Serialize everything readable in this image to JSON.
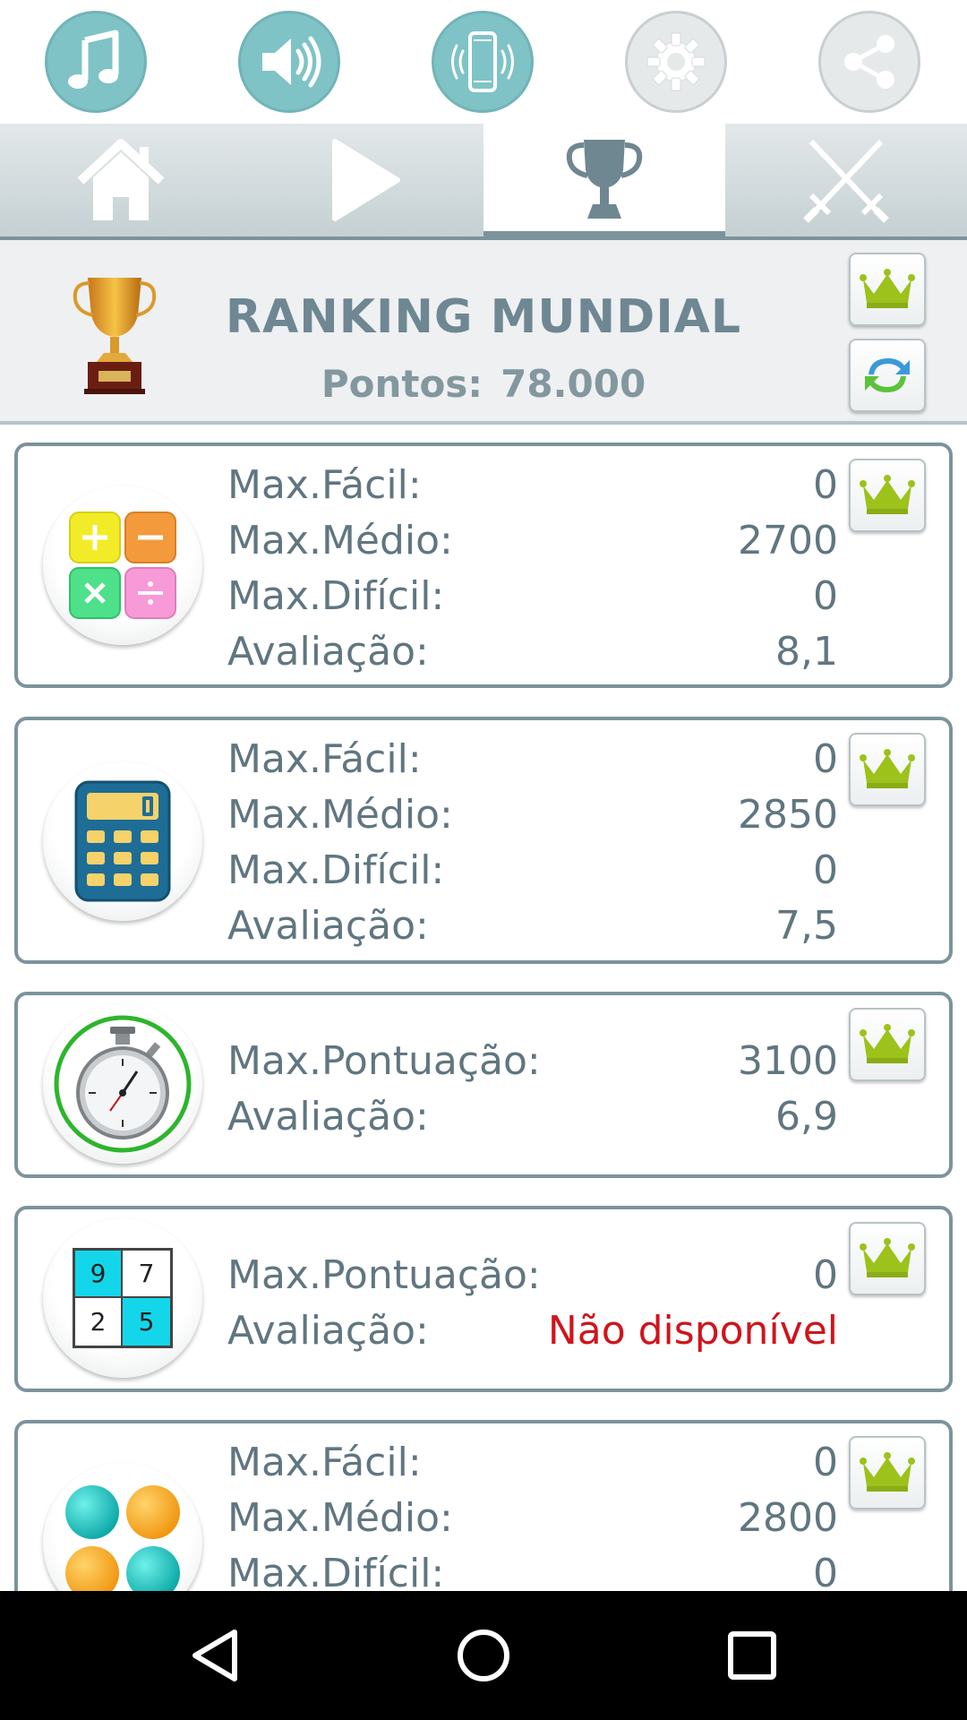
{
  "top_icons": [
    {
      "name": "music-icon"
    },
    {
      "name": "sound-icon"
    },
    {
      "name": "vibrate-icon"
    },
    {
      "name": "settings-icon"
    },
    {
      "name": "share-icon"
    }
  ],
  "tabs": [
    {
      "name": "home-icon",
      "active": false
    },
    {
      "name": "play-icon",
      "active": false
    },
    {
      "name": "trophy-icon",
      "active": true
    },
    {
      "name": "swords-icon",
      "active": false
    }
  ],
  "header": {
    "title": "RANKING MUNDIAL",
    "points_label": "Pontos:",
    "points_value": "78.000"
  },
  "games": [
    {
      "icon": "math-operations-icon",
      "stats": [
        {
          "label": "Max.Fácil:",
          "value": "0"
        },
        {
          "label": "Max.Médio:",
          "value": "2700"
        },
        {
          "label": "Max.Difícil:",
          "value": "0"
        },
        {
          "label": "Avaliação:",
          "value": "8,1"
        }
      ]
    },
    {
      "icon": "calculator-icon",
      "stats": [
        {
          "label": "Max.Fácil:",
          "value": "0"
        },
        {
          "label": "Max.Médio:",
          "value": "2850"
        },
        {
          "label": "Max.Difícil:",
          "value": "0"
        },
        {
          "label": "Avaliação:",
          "value": "7,5"
        }
      ]
    },
    {
      "icon": "stopwatch-icon",
      "stats": [
        {
          "label": "Max.Pontuação:",
          "value": "3100"
        },
        {
          "label": "Avaliação:",
          "value": "6,9"
        }
      ]
    },
    {
      "icon": "number-grid-icon",
      "grid_numbers": [
        "9",
        "7",
        "2",
        "5"
      ],
      "stats": [
        {
          "label": "Max.Pontuação:",
          "value": "0"
        },
        {
          "label": "Avaliação:",
          "value": "Não disponível"
        }
      ]
    },
    {
      "icon": "colored-balls-icon",
      "stats": [
        {
          "label": "Max.Fácil:",
          "value": "0"
        },
        {
          "label": "Max.Médio:",
          "value": "2800"
        },
        {
          "label": "Max.Difícil:",
          "value": "0"
        }
      ]
    }
  ],
  "colors": {
    "teal": "#7fc3c6",
    "slate": "#7c939c",
    "crown_green": "#9cc21b",
    "unavailable_red": "#d0141c"
  }
}
